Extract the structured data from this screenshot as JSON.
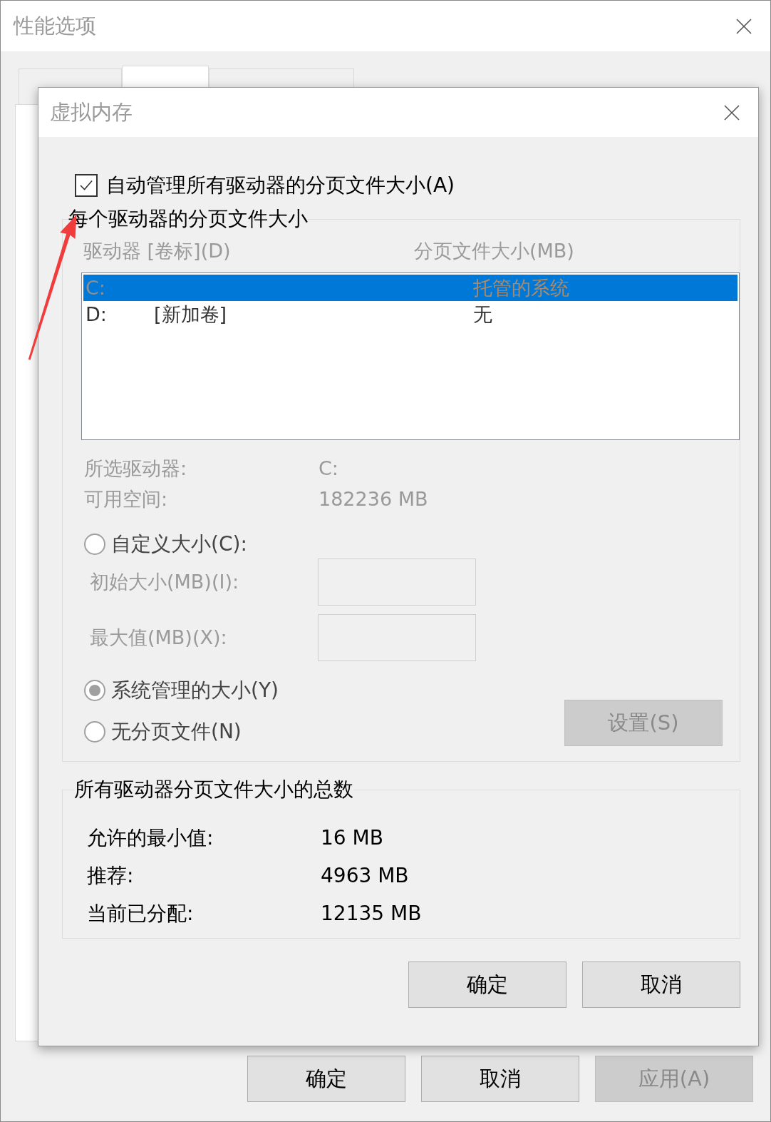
{
  "window": {
    "title": "性能选项"
  },
  "tabs": [
    {
      "selected": false
    },
    {
      "selected": true
    },
    {
      "selected": false
    }
  ],
  "dialog": {
    "title": "虚拟内存",
    "auto_manage": {
      "label": "自动管理所有驱动器的分页文件大小(A)",
      "checked": true
    },
    "per_drive": {
      "title": "每个驱动器的分页文件大小",
      "disabled": true,
      "columns": [
        "驱动器 [卷标](D)",
        "分页文件大小(MB)"
      ],
      "drives": [
        {
          "drive": "C:",
          "size": "托管的系统",
          "selected": true
        },
        {
          "drive": "D:",
          "volume": "[新加卷]",
          "size": "无",
          "selected": false
        }
      ],
      "info": [
        {
          "label": "所选驱动器:",
          "value": "C:"
        },
        {
          "label": "可用空间:",
          "value": "182236 MB"
        }
      ],
      "options": [
        {
          "kind": "radio",
          "label": "自定义大小(C):",
          "selected": false
        },
        {
          "kind": "field",
          "label": "初始大小(MB)(I):"
        },
        {
          "kind": "field",
          "label": "最大值(MB)(X):"
        },
        {
          "kind": "radio",
          "label": "系统管理的大小(Y)",
          "selected": true
        },
        {
          "kind": "radio",
          "label": "无分页文件(N)",
          "selected": false
        }
      ],
      "set_button": {
        "label": "设置(S)",
        "disabled": true
      }
    },
    "totals": {
      "title": "所有驱动器分页文件大小的总数",
      "rows": [
        {
          "label": "允许的最小值:",
          "value": "16 MB"
        },
        {
          "label": "推荐:",
          "value": "4963 MB"
        },
        {
          "label": "当前已分配:",
          "value": "12135 MB"
        }
      ]
    },
    "buttons": [
      {
        "label": "确定",
        "disabled": false
      },
      {
        "label": "取消",
        "disabled": false
      }
    ]
  },
  "buttons": [
    {
      "label": "确定",
      "disabled": false
    },
    {
      "label": "取消",
      "disabled": false
    },
    {
      "label": "应用(A)",
      "disabled": true
    }
  ]
}
